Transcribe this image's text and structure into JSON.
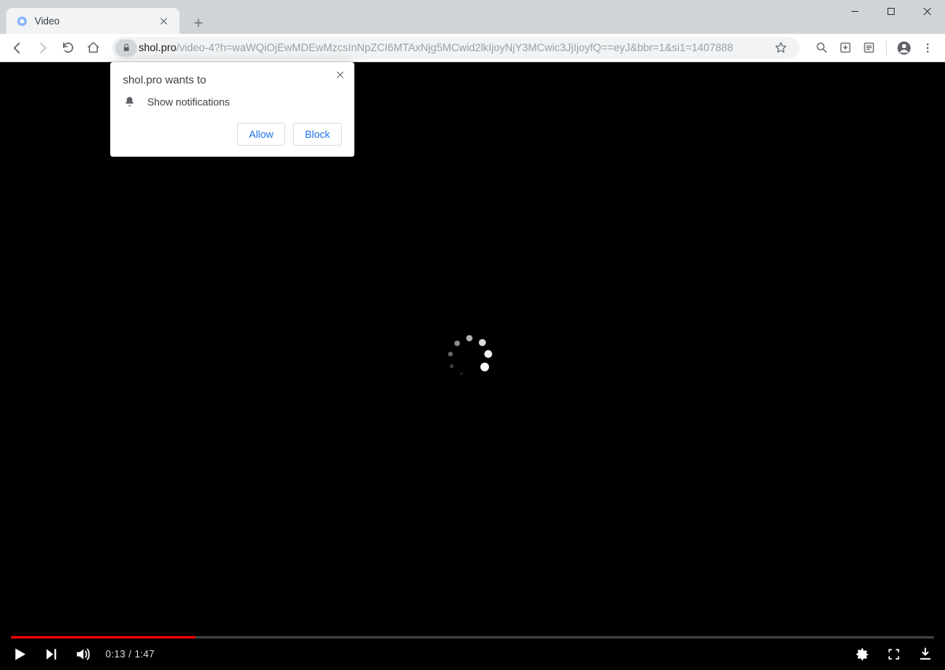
{
  "window": {
    "title": "Video"
  },
  "tab": {
    "title": "Video"
  },
  "url": {
    "host": "shol.pro",
    "path": "/video-4?h=waWQiOjEwMDEwMzcsInNpZCI6MTAxNjg5MCwid2lkIjoyNjY3MCwic3JjIjoyfQ==eyJ&bbr=1&si1=1407888"
  },
  "permission": {
    "title": "shol.pro wants to",
    "item": "Show notifications",
    "allow": "Allow",
    "block": "Block"
  },
  "player": {
    "current_time": "0:13",
    "duration": "1:47",
    "progress_percent": 20
  }
}
